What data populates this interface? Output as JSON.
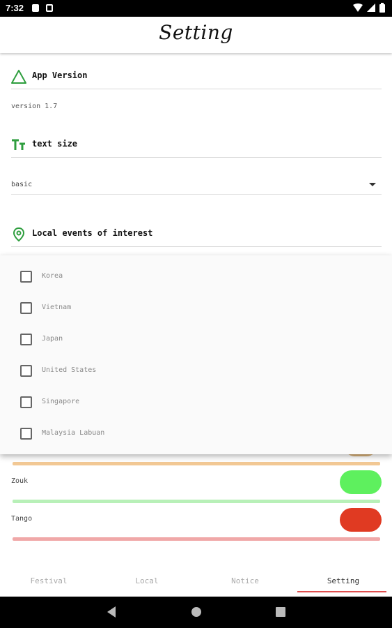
{
  "status_bar": {
    "time": "7:32",
    "icons": [
      "sim-card-icon",
      "sd-card-icon",
      "wifi-icon",
      "signal-icon",
      "battery-icon"
    ]
  },
  "header": {
    "title": "Setting"
  },
  "sections": {
    "app_version": {
      "title": "App Version",
      "icon": "warning-triangle-icon",
      "value": "version 1.7"
    },
    "text_size": {
      "title": "text size",
      "icon": "text-size-icon",
      "selected": "basic"
    },
    "local_events": {
      "title": "Local events of interest",
      "icon": "location-pin-icon"
    }
  },
  "dropdown": {
    "items": [
      {
        "label": "Korea",
        "checked": false
      },
      {
        "label": "Vietnam",
        "checked": false
      },
      {
        "label": "Japan",
        "checked": false
      },
      {
        "label": "United States",
        "checked": false
      },
      {
        "label": "Singapore",
        "checked": false
      },
      {
        "label": "Malaysia Labuan",
        "checked": false
      }
    ]
  },
  "genres": [
    {
      "label": "",
      "color": "#d9b27a",
      "line_color": "#f2c894"
    },
    {
      "label": "Zouk",
      "color": "#5ef05e",
      "line_color": "#b8f0b8"
    },
    {
      "label": "Tango",
      "color": "#e03a22",
      "line_color": "#f0a8a8"
    }
  ],
  "bottom_nav": {
    "tabs": [
      {
        "label": "Festival",
        "active": false
      },
      {
        "label": "Local",
        "active": false
      },
      {
        "label": "Notice",
        "active": false
      },
      {
        "label": "Setting",
        "active": true
      }
    ],
    "accent": "#e05050"
  },
  "system_nav": {
    "buttons": [
      "back-icon",
      "home-icon",
      "recents-icon"
    ]
  },
  "colors": {
    "icon_green": "#2e9e3e"
  }
}
